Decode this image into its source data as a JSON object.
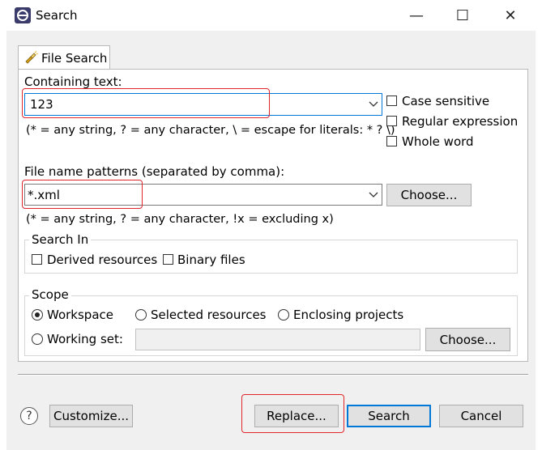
{
  "window": {
    "title": "Search",
    "minimize_glyph": "—",
    "maximize_glyph": "☐",
    "close_glyph": "✕"
  },
  "tab": {
    "label": "File Search",
    "icon": "flashlight-icon"
  },
  "containing": {
    "label": "Containing text:",
    "value": "123",
    "hint": "(* = any string, ? = any character, \\ = escape for literals: * ? \\)",
    "case_sensitive": "Case sensitive",
    "regex": "Regular expression",
    "whole_word": "Whole word"
  },
  "patterns": {
    "label": "File name patterns (separated by comma):",
    "value": "*.xml",
    "hint": "(* = any string, ? = any character, !x = excluding x)",
    "choose": "Choose..."
  },
  "search_in": {
    "title": "Search In",
    "derived": "Derived resources",
    "binary": "Binary files"
  },
  "scope": {
    "title": "Scope",
    "workspace": "Workspace",
    "selected": "Selected resources",
    "enclosing": "Enclosing projects",
    "working_set": "Working set:",
    "working_set_value": "",
    "choose": "Choose...",
    "selected_option": "Workspace"
  },
  "footer": {
    "help": "?",
    "customize": "Customize...",
    "replace": "Replace...",
    "search": "Search",
    "cancel": "Cancel"
  },
  "colors": {
    "accent": "#0078d7",
    "annotation": "#e0262b"
  }
}
